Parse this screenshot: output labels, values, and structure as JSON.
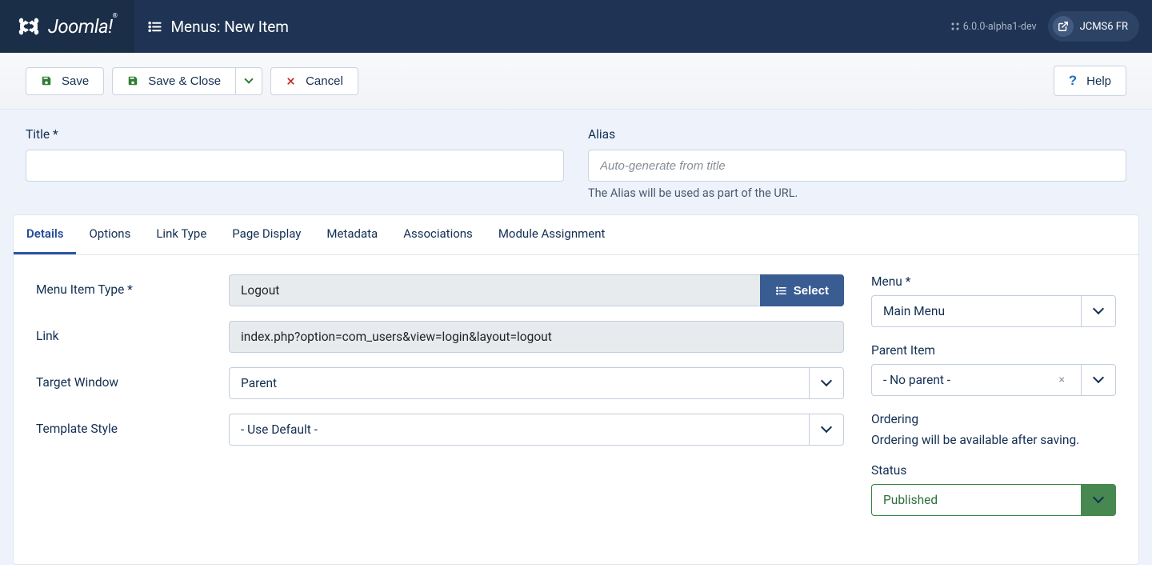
{
  "header": {
    "logo_text": "Joomla!",
    "page_title": "Menus: New Item",
    "version": "6.0.0-alpha1-dev",
    "site_name": "JCMS6 FR"
  },
  "toolbar": {
    "save": "Save",
    "save_close": "Save & Close",
    "cancel": "Cancel",
    "help": "Help"
  },
  "top": {
    "title_label": "Title",
    "alias_label": "Alias",
    "alias_placeholder": "Auto-generate from title",
    "alias_help": "The Alias will be used as part of the URL."
  },
  "tabs": [
    "Details",
    "Options",
    "Link Type",
    "Page Display",
    "Metadata",
    "Associations",
    "Module Assignment"
  ],
  "details": {
    "menu_item_type_label": "Menu Item Type",
    "menu_item_type_value": "Logout",
    "select_btn": "Select",
    "link_label": "Link",
    "link_value": "index.php?option=com_users&view=login&layout=logout",
    "target_label": "Target Window",
    "target_value": "Parent",
    "template_label": "Template Style",
    "template_value": "- Use Default -"
  },
  "side": {
    "menu_label": "Menu",
    "menu_value": "Main Menu",
    "parent_label": "Parent Item",
    "parent_value": "- No parent -",
    "ordering_label": "Ordering",
    "ordering_text": "Ordering will be available after saving.",
    "status_label": "Status",
    "status_value": "Published"
  }
}
